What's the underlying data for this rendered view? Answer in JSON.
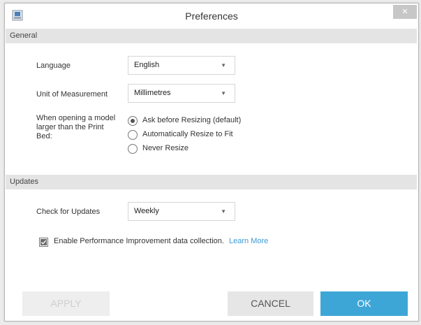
{
  "window": {
    "title": "Preferences",
    "close_label": "×"
  },
  "general": {
    "header": "General",
    "language": {
      "label": "Language",
      "value": "English"
    },
    "unit": {
      "label": "Unit of Measurement",
      "value": "Millimetres"
    },
    "resize": {
      "label": "When opening a model larger than the Print Bed:",
      "options": [
        {
          "label": "Ask before Resizing (default)",
          "checked": true
        },
        {
          "label": "Automatically Resize to Fit",
          "checked": false
        },
        {
          "label": "Never Resize",
          "checked": false
        }
      ]
    }
  },
  "updates": {
    "header": "Updates",
    "check": {
      "label": "Check for Updates",
      "value": "Weekly"
    },
    "performance": {
      "label": "Enable Performance Improvement data collection.",
      "checked": true,
      "link": "Learn More"
    }
  },
  "buttons": {
    "apply": "APPLY",
    "cancel": "CANCEL",
    "ok": "OK"
  },
  "icons": {
    "dropdown_arrow": "▼"
  },
  "colors": {
    "accent": "#3ea6d6",
    "link": "#3b9bd6",
    "section_bg": "#e4e4e4"
  }
}
